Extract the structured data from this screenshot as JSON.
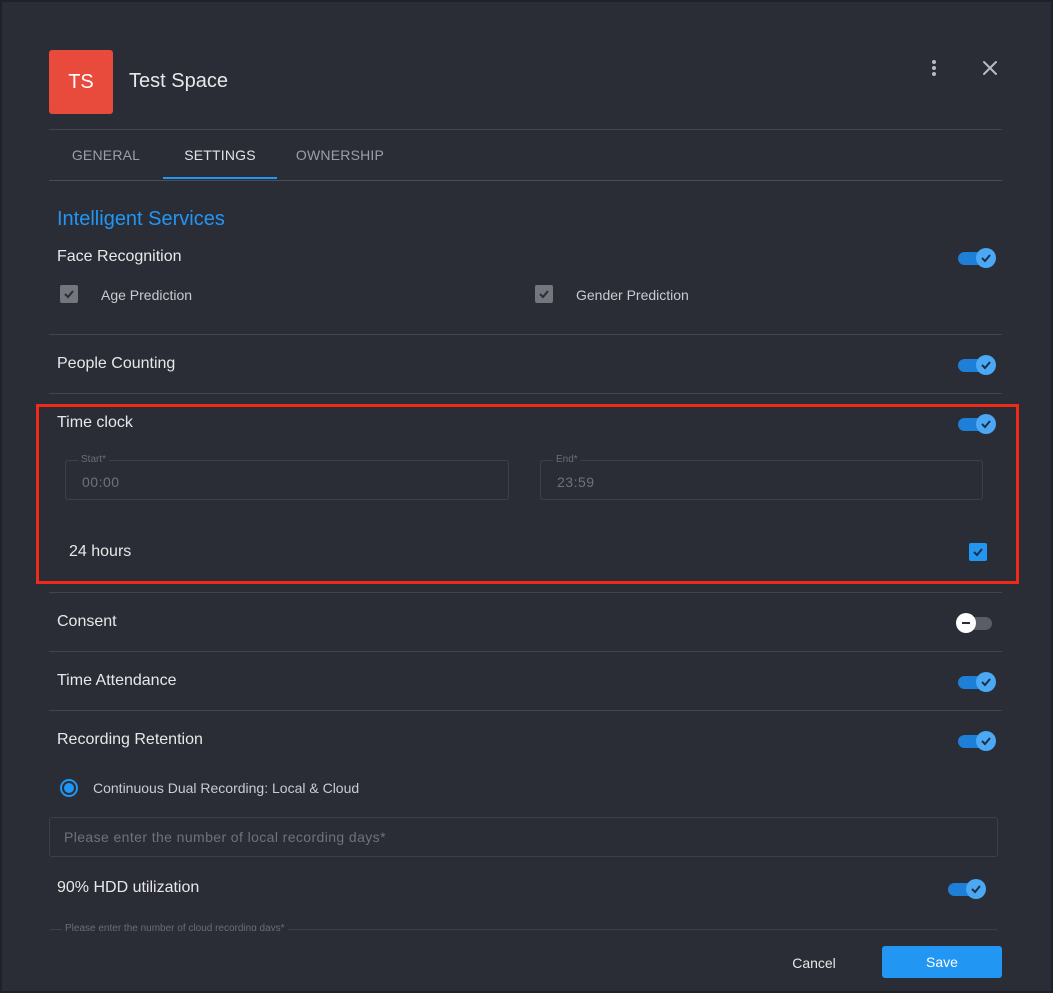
{
  "header": {
    "avatar_initials": "TS",
    "title": "Test Space",
    "menu_icon": "more-vert-icon",
    "close_icon": "close-icon"
  },
  "tabs": [
    {
      "label": "GENERAL",
      "active": false
    },
    {
      "label": "SETTINGS",
      "active": true
    },
    {
      "label": "OWNERSHIP",
      "active": false
    }
  ],
  "section_title": "Intelligent Services",
  "face_recognition": {
    "label": "Face Recognition",
    "enabled": true,
    "options": [
      {
        "label": "Age Prediction",
        "checked": true
      },
      {
        "label": "Gender Prediction",
        "checked": true
      }
    ]
  },
  "people_counting": {
    "label": "People Counting",
    "enabled": true
  },
  "time_clock": {
    "label": "Time clock",
    "enabled": true,
    "start": {
      "label": "Start*",
      "value": "00:00"
    },
    "end": {
      "label": "End*",
      "value": "23:59"
    },
    "all_day": {
      "label": "24 hours",
      "checked": true
    }
  },
  "consent": {
    "label": "Consent",
    "enabled": false
  },
  "time_attendance": {
    "label": "Time Attendance",
    "enabled": true
  },
  "recording_retention": {
    "label": "Recording Retention",
    "enabled": true,
    "mode_label": "Continuous Dual Recording: Local & Cloud",
    "local_days_placeholder": "Please enter the number of local recording days*",
    "hdd": {
      "label": "90% HDD utilization",
      "enabled": true
    },
    "cloud_days_label": "Please enter the number of cloud recording days*"
  },
  "footer": {
    "cancel_label": "Cancel",
    "save_label": "Save"
  },
  "colors": {
    "accent": "#2196f3",
    "avatar": "#e84a3c",
    "highlight": "#ef2a1a",
    "background": "#2a2d35"
  }
}
